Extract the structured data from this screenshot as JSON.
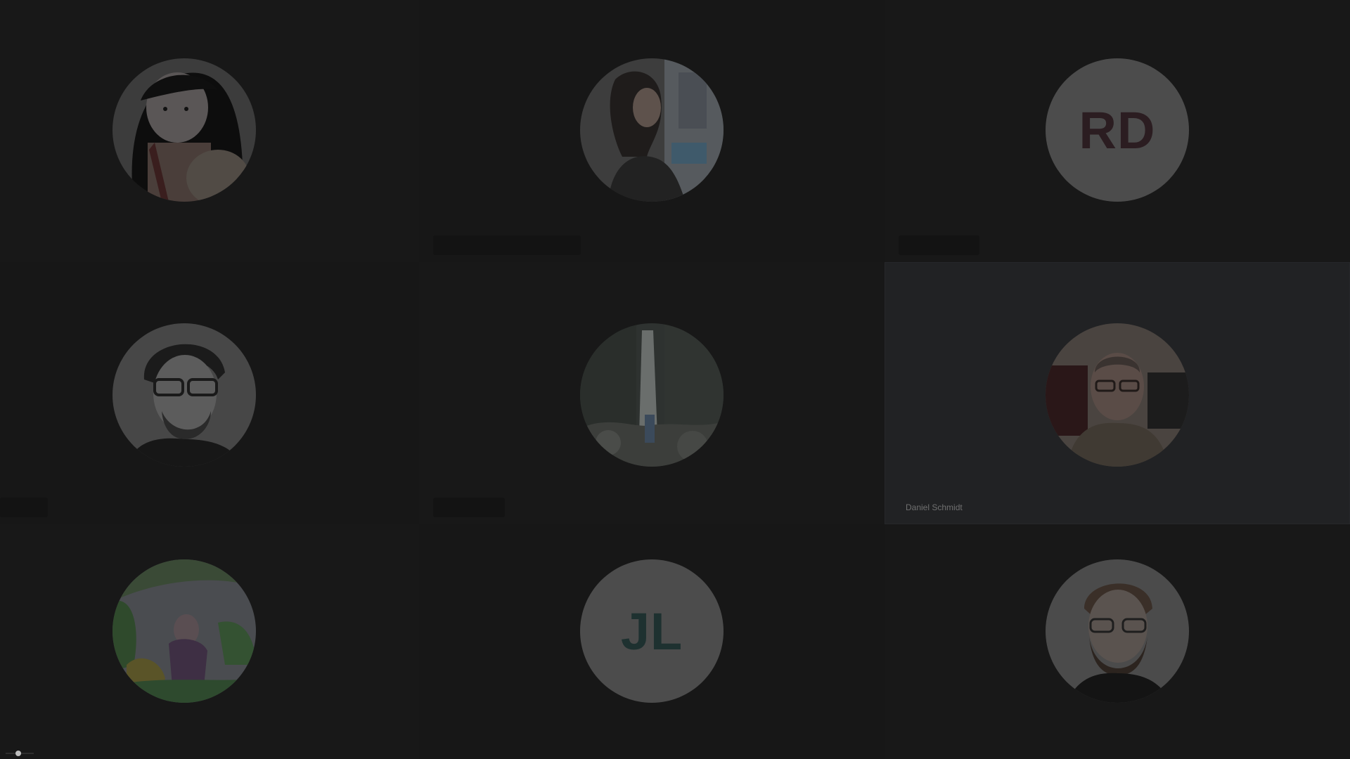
{
  "meeting": {
    "participants": [
      {
        "id": "p1",
        "avatar": "cartoon-portrait",
        "initials": "",
        "name": ""
      },
      {
        "id": "p2",
        "avatar": "woman-photo",
        "initials": "",
        "name": ""
      },
      {
        "id": "p3",
        "avatar": "initials",
        "initials": "RD",
        "name": ""
      },
      {
        "id": "p4",
        "avatar": "man-glasses-bw-photo",
        "initials": "",
        "name": ""
      },
      {
        "id": "p5",
        "avatar": "waterfall-landscape",
        "initials": "",
        "name": ""
      },
      {
        "id": "p6",
        "avatar": "man-photo",
        "initials": "",
        "name": "Daniel Schmidt",
        "active": true
      },
      {
        "id": "p7",
        "avatar": "illustrated-scene",
        "initials": "",
        "name": ""
      },
      {
        "id": "p8",
        "avatar": "initials",
        "initials": "JL",
        "name": ""
      },
      {
        "id": "p9",
        "avatar": "bearded-man-photo",
        "initials": "",
        "name": ""
      }
    ]
  },
  "colors": {
    "background": "#111111",
    "tile": "#181818",
    "active_tile": "#212224",
    "initials_circle": "#4c4c4c"
  }
}
